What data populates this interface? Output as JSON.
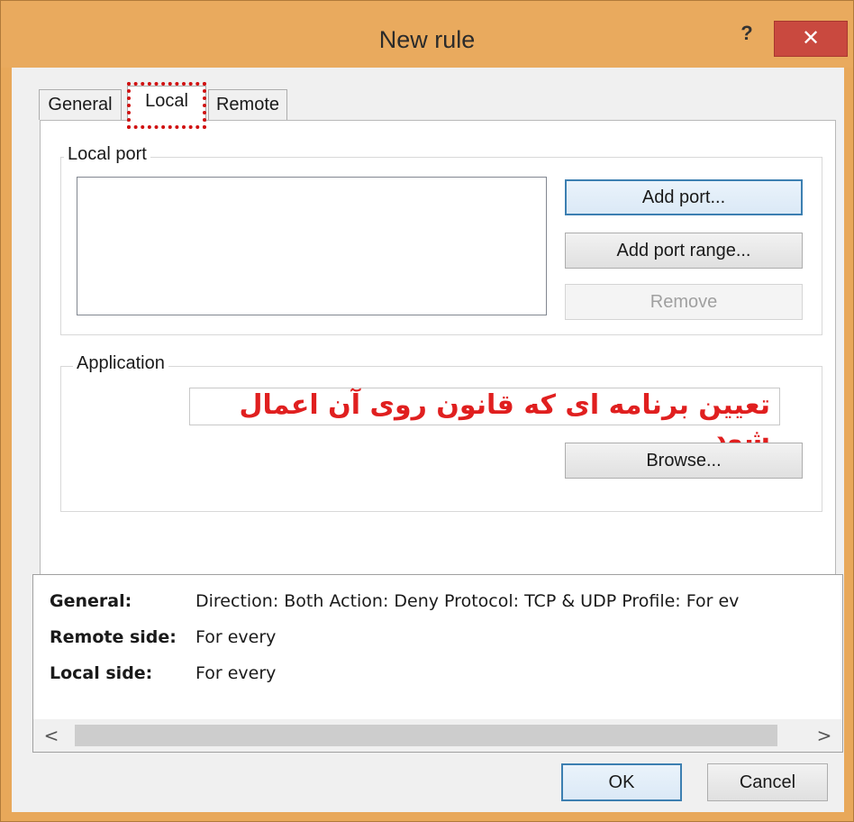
{
  "window": {
    "title": "New rule",
    "help_glyph": "?",
    "close_glyph": "✕"
  },
  "tabs": [
    {
      "label": "General"
    },
    {
      "label": "Local",
      "active": true
    },
    {
      "label": "Remote"
    }
  ],
  "local_port": {
    "group_label": "Local port",
    "add_port_label": "Add port...",
    "add_port_range_label": "Add port range...",
    "remove_label": "Remove"
  },
  "application": {
    "group_label": "Application",
    "annotation_text": "تعیین برنامه ای که قانون روی آن اعمال شود",
    "browse_label": "Browse..."
  },
  "summary": {
    "general_key": "General:",
    "general_value": "Direction: Both   Action: Deny   Protocol: TCP & UDP   Profile: For ev",
    "remote_key": "Remote side:",
    "remote_value": "For every",
    "local_key": "Local side:",
    "local_value": "For every"
  },
  "scrollbar": {
    "left_arrow": "<",
    "right_arrow": ">"
  },
  "footer": {
    "ok_label": "OK",
    "cancel_label": "Cancel"
  },
  "colors": {
    "titlebar": "#e9aa5e",
    "close_button": "#c9493f",
    "annotation_text": "#e01f1f",
    "focus_highlight": "#d01010"
  }
}
